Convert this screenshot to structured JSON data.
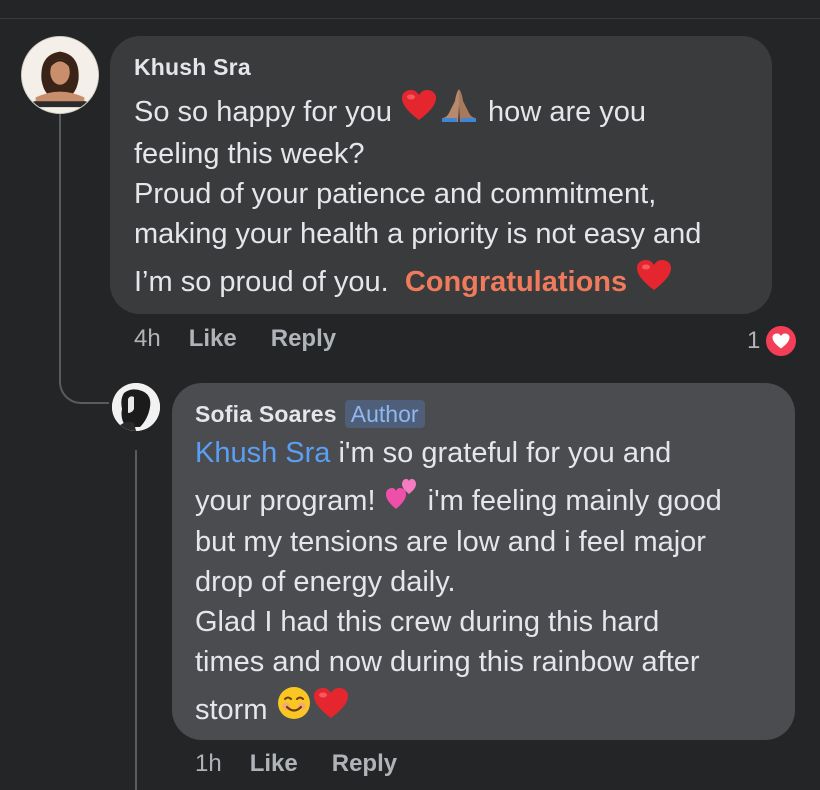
{
  "comments": [
    {
      "author": "Khush Sra",
      "lines": [
        {
          "before": "So so happy for you ",
          "after": " how are you"
        },
        {
          "text": "feeling this week?"
        },
        {
          "text": "Proud of your patience and commitment,"
        },
        {
          "text": "making your health a priority is not easy and"
        },
        {
          "text": "I’m so proud of you.  ",
          "highlight": "Congratulations"
        }
      ],
      "time": "4h",
      "like_label": "Like",
      "reply_label": "Reply",
      "reaction_count": "1",
      "avatar_icon": "profile-photo-icon"
    },
    {
      "author": "Sofia Soares",
      "badge": "Author",
      "tag": "Khush Sra",
      "lines": [
        {
          "after_tag": " i'm so grateful for you and"
        },
        {
          "before": "your program! ",
          "after": " i'm feeling mainly good"
        },
        {
          "text": "but my tensions are low and i feel major"
        },
        {
          "text": "drop of energy daily."
        },
        {
          "text": "Glad I had this crew during this hard"
        },
        {
          "text": "times and now during this rainbow after"
        },
        {
          "text": "storm "
        }
      ],
      "time": "1h",
      "like_label": "Like",
      "reply_label": "Reply",
      "avatar_icon": "profile-photo-icon"
    }
  ],
  "colors": {
    "background": "#242526",
    "bubble": "#3a3b3c",
    "reply_bubble": "#4b4c4f",
    "link": "#5a9ff5",
    "highlight": "#f07a5c",
    "reaction_heart": "#f33e58"
  }
}
